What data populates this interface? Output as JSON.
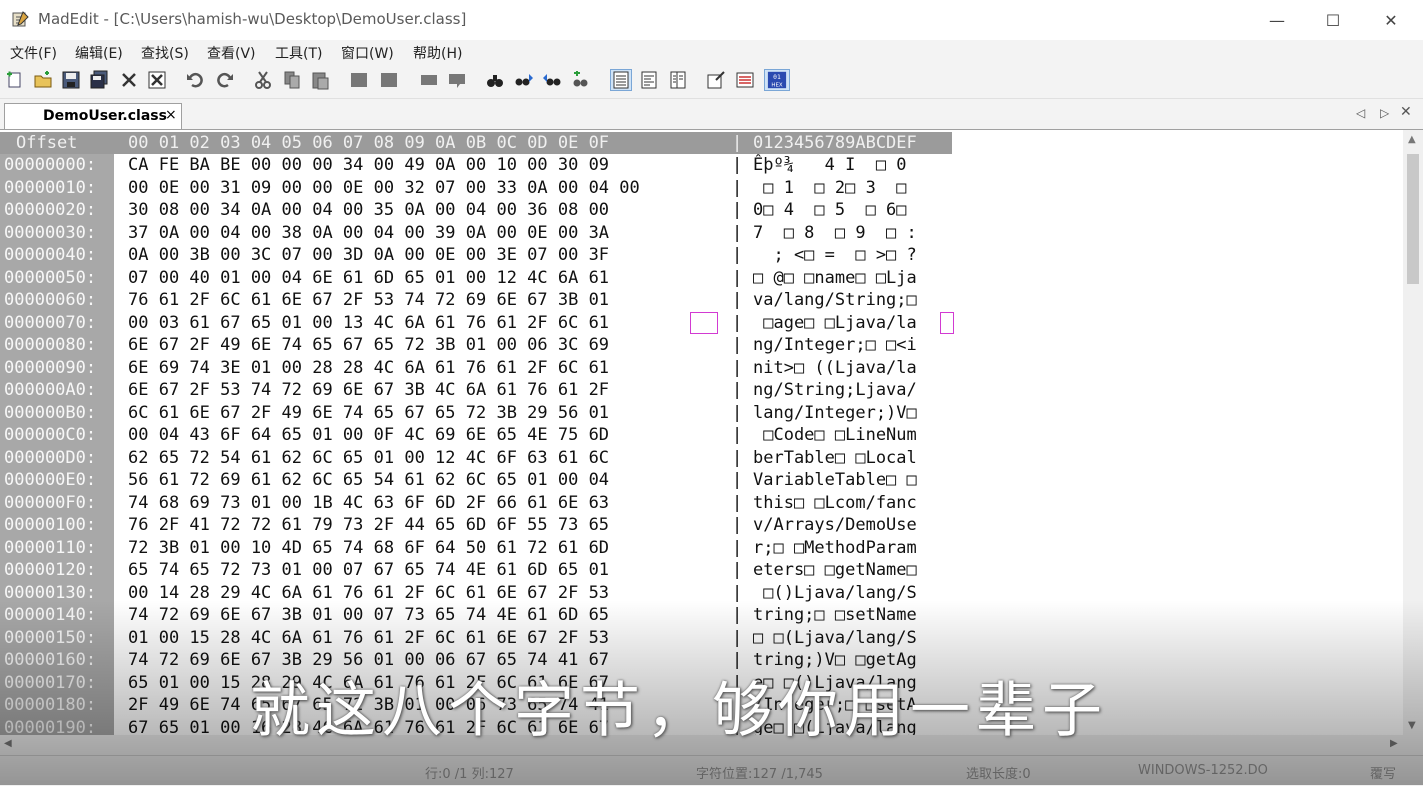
{
  "window": {
    "title": "MadEdit - [C:\\Users\\hamish-wu\\Desktop\\DemoUser.class]",
    "minimize": "—",
    "maximize": "☐",
    "close": "✕"
  },
  "menu": [
    "文件(F)",
    "编辑(E)",
    "查找(S)",
    "查看(V)",
    "工具(T)",
    "窗口(W)",
    "帮助(H)"
  ],
  "toolbar": {
    "icons": [
      "new-file-icon",
      "open-file-icon",
      "save-icon",
      "save-all-icon",
      "close-file-icon",
      "close-all-icon",
      "undo-icon",
      "redo-icon",
      "cut-icon",
      "copy-icon",
      "paste-icon",
      "indent-icon",
      "unindent-icon",
      "comment-icon",
      "uncomment-icon",
      "find-icon",
      "find-next-icon",
      "find-prev-icon",
      "replace-icon",
      "text-mode-icon",
      "column-mode-icon",
      "hex-mode-icon",
      "word-wrap-icon",
      "options-icon",
      "hex-view-icon"
    ],
    "hex_label": "01 HEX"
  },
  "tab": {
    "label": "DemoUser.class",
    "close": "×"
  },
  "hex": {
    "header_offset": "Offset",
    "header_columns": "00 01 02 03 04 05 06 07 08 09 0A 0B 0C 0D 0E 0F",
    "header_ascii": "0123456789ABCDEF",
    "rows": [
      {
        "offset": "00000000:",
        "hex": "CA FE BA BE 00 00 00 34 00 49 0A 00 10 00 30 09",
        "ascii": "Êþº¾   4 I  □ 0 "
      },
      {
        "offset": "00000010:",
        "hex": "00 0E 00 31 09 00 00 0E 00 32 07 00 33 0A 00 04 00",
        "ascii": " □ 1  □ 2□ 3  □"
      },
      {
        "offset": "00000020:",
        "hex": "30 08 00 34 0A 00 04 00 35 0A 00 04 00 36 08 00",
        "ascii": "0□ 4  □ 5  □ 6□"
      },
      {
        "offset": "00000030:",
        "hex": "37 0A 00 04 00 38 0A 00 04 00 39 0A 00 0E 00 3A",
        "ascii": "7  □ 8  □ 9  □ :"
      },
      {
        "offset": "00000040:",
        "hex": "0A 00 3B 00 3C 07 00 3D 0A 00 0E 00 3E 07 00 3F",
        "ascii": "  ; <□ =  □ >□ ?"
      },
      {
        "offset": "00000050:",
        "hex": "07 00 40 01 00 04 6E 61 6D 65 01 00 12 4C 6A 61",
        "ascii": "□ @□ □name□ □Lja"
      },
      {
        "offset": "00000060:",
        "hex": "76 61 2F 6C 61 6E 67 2F 53 74 72 69 6E 67 3B 01",
        "ascii": "va/lang/String;□"
      },
      {
        "offset": "00000070:",
        "hex": "00 03 61 67 65 01 00 13 4C 6A 61 76 61 2F 6C 61",
        "ascii": " □age□ □Ljava/la"
      },
      {
        "offset": "00000080:",
        "hex": "6E 67 2F 49 6E 74 65 67 65 72 3B 01 00 06 3C 69",
        "ascii": "ng/Integer;□ □<i"
      },
      {
        "offset": "00000090:",
        "hex": "6E 69 74 3E 01 00 28 28 4C 6A 61 76 61 2F 6C 61",
        "ascii": "nit>□ ((Ljava/la"
      },
      {
        "offset": "000000A0:",
        "hex": "6E 67 2F 53 74 72 69 6E 67 3B 4C 6A 61 76 61 2F",
        "ascii": "ng/String;Ljava/"
      },
      {
        "offset": "000000B0:",
        "hex": "6C 61 6E 67 2F 49 6E 74 65 67 65 72 3B 29 56 01",
        "ascii": "lang/Integer;)V□"
      },
      {
        "offset": "000000C0:",
        "hex": "00 04 43 6F 64 65 01 00 0F 4C 69 6E 65 4E 75 6D",
        "ascii": " □Code□ □LineNum"
      },
      {
        "offset": "000000D0:",
        "hex": "62 65 72 54 61 62 6C 65 01 00 12 4C 6F 63 61 6C",
        "ascii": "berTable□ □Local"
      },
      {
        "offset": "000000E0:",
        "hex": "56 61 72 69 61 62 6C 65 54 61 62 6C 65 01 00 04",
        "ascii": "VariableTable□ □"
      },
      {
        "offset": "000000F0:",
        "hex": "74 68 69 73 01 00 1B 4C 63 6F 6D 2F 66 61 6E 63",
        "ascii": "this□ □Lcom/fanc"
      },
      {
        "offset": "00000100:",
        "hex": "76 2F 41 72 72 61 79 73 2F 44 65 6D 6F 55 73 65",
        "ascii": "v/Arrays/DemoUse"
      },
      {
        "offset": "00000110:",
        "hex": "72 3B 01 00 10 4D 65 74 68 6F 64 50 61 72 61 6D",
        "ascii": "r;□ □MethodParam"
      },
      {
        "offset": "00000120:",
        "hex": "65 74 65 72 73 01 00 07 67 65 74 4E 61 6D 65 01",
        "ascii": "eters□ □getName□"
      },
      {
        "offset": "00000130:",
        "hex": "00 14 28 29 4C 6A 61 76 61 2F 6C 61 6E 67 2F 53",
        "ascii": " □()Ljava/lang/S"
      },
      {
        "offset": "00000140:",
        "hex": "74 72 69 6E 67 3B 01 00 07 73 65 74 4E 61 6D 65",
        "ascii": "tring;□ □setName"
      },
      {
        "offset": "00000150:",
        "hex": "01 00 15 28 4C 6A 61 76 61 2F 6C 61 6E 67 2F 53",
        "ascii": "□ □(Ljava/lang/S"
      },
      {
        "offset": "00000160:",
        "hex": "74 72 69 6E 67 3B 29 56 01 00 06 67 65 74 41 67",
        "ascii": "tring;)V□ □getAg"
      },
      {
        "offset": "00000170:",
        "hex": "65 01 00 15 28 29 4C 6A 61 76 61 2F 6C 61 6E 67",
        "ascii": "e□ □()Ljava/lang"
      },
      {
        "offset": "00000180:",
        "hex": "2F 49 6E 74 65 67 65 72 3B 01 00 06 73 65 74 41",
        "ascii": "/Integer;□ □setA"
      },
      {
        "offset": "00000190:",
        "hex": "67 65 01 00 16 28 4C 6A 61 76 61 2F 6C 61 6E 67",
        "ascii": "ge□ □(Ljava/lang"
      }
    ],
    "separator": "|",
    "cursor_row": 7,
    "cursor_col": 15
  },
  "status": {
    "position": "行:0 /1 列:127",
    "char_pos": "字符位置:127 /1,745",
    "selection": "选取长度:0",
    "encoding": "WINDOWS-1252.DO",
    "mode": "覆写"
  },
  "subtitle": "就这八个字节，够你用一辈子",
  "colors": {
    "offset_bg": "#a8a8a8",
    "header_bg": "#9b9b9b",
    "cursor": "#d23ad2",
    "toolbar_toggle": "#cfe3f7"
  }
}
